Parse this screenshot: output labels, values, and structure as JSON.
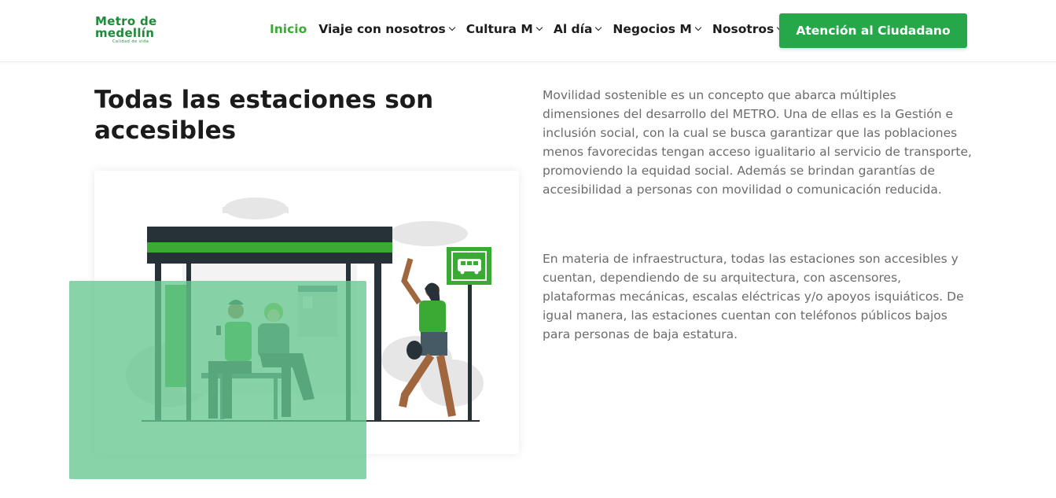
{
  "header": {
    "logo": {
      "line1": "Metro de",
      "line2": "medellín",
      "tagline": "Calidad de vida"
    },
    "nav": [
      {
        "label": "Inicio",
        "active": true,
        "dropdown": false
      },
      {
        "label": "Viaje con nosotros",
        "active": false,
        "dropdown": true
      },
      {
        "label": "Cultura M",
        "active": false,
        "dropdown": true
      },
      {
        "label": "Al día",
        "active": false,
        "dropdown": true
      },
      {
        "label": "Negocios M",
        "active": false,
        "dropdown": true
      },
      {
        "label": "Nosotros",
        "active": false,
        "dropdown": true
      }
    ],
    "cta_label": "Atención al Ciudadano"
  },
  "content": {
    "title": "Todas las estaciones son accesibles",
    "paragraph1": "Movilidad sostenible es un concepto que abarca múltiples dimensiones del desarrollo del METRO. Una de ellas es la Gestión e inclusión social, con la cual se busca garantizar que las poblaciones menos favorecidas tengan acceso igualitario al servicio de transporte, promoviendo la equidad social. Además se brindan garantías de accesibilidad a personas con movilidad o comunicación reducida.",
    "paragraph2": "En materia de infraestructura, todas las estaciones son accesibles y cuentan, dependiendo de su arquitectura, con ascensores, plataformas mecánicas, escalas eléctricas y/o apoyos isquiáticos. De igual manera, las estaciones cuentan con teléfonos públicos bajos para personas de baja estatura."
  },
  "illustration": {
    "icon": "bus-stop-illustration",
    "sign_icon": "bus-icon"
  },
  "colors": {
    "brand": "#26a84a",
    "active_nav": "#3aaa35",
    "text_body": "#6b6b6b",
    "overlay": "#66c78e"
  }
}
